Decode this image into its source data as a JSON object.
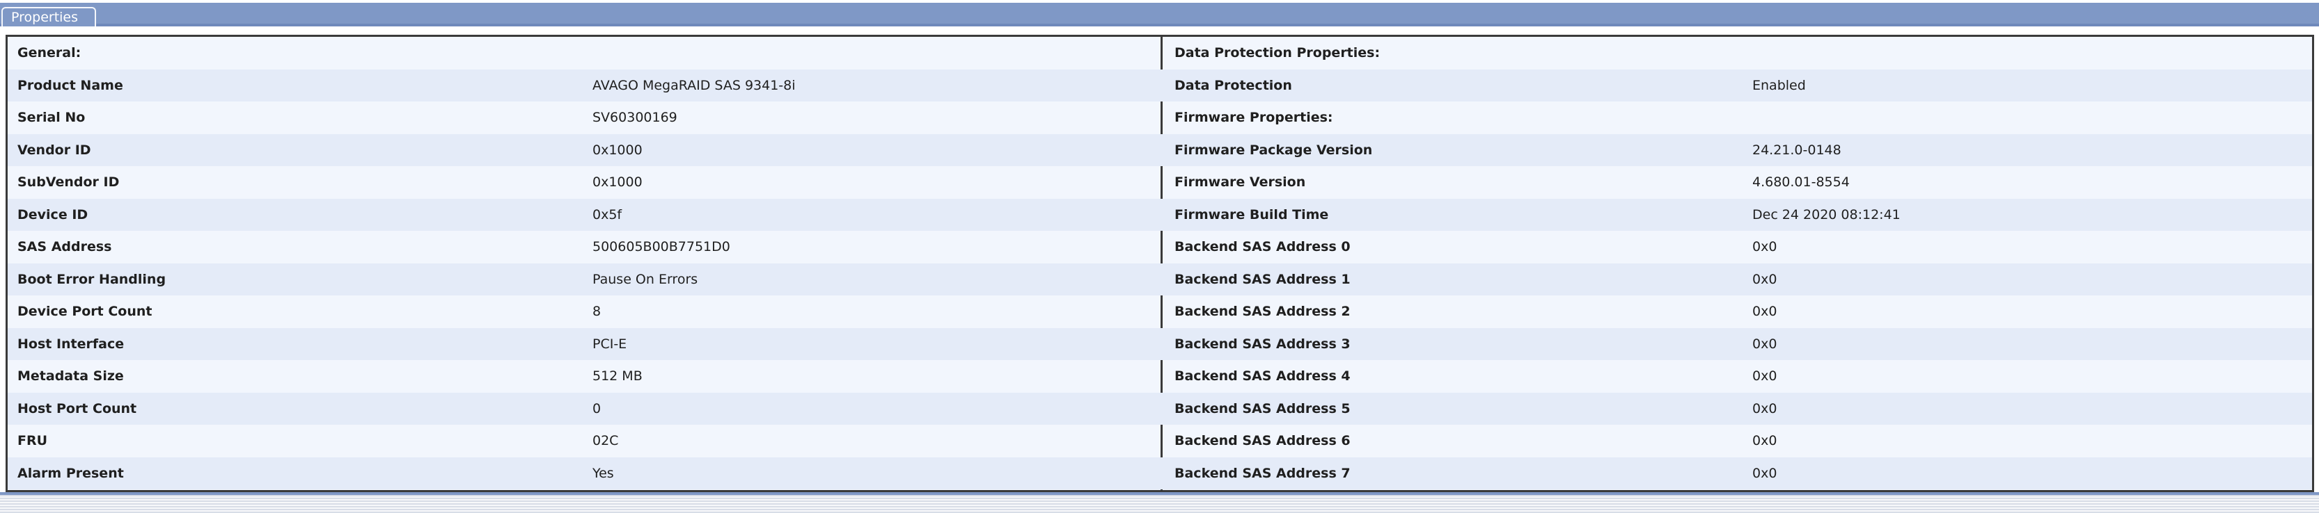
{
  "tab": {
    "label": "Properties"
  },
  "left_rows": [
    {
      "key": "General:",
      "value": ""
    },
    {
      "key": "Product Name",
      "value": "AVAGO MegaRAID SAS 9341-8i"
    },
    {
      "key": "Serial No",
      "value": "SV60300169"
    },
    {
      "key": "Vendor ID",
      "value": "0x1000"
    },
    {
      "key": "SubVendor ID",
      "value": "0x1000"
    },
    {
      "key": "Device ID",
      "value": "0x5f"
    },
    {
      "key": "SAS Address",
      "value": "500605B00B7751D0"
    },
    {
      "key": "Boot Error Handling",
      "value": "Pause On Errors"
    },
    {
      "key": "Device Port Count",
      "value": "8"
    },
    {
      "key": "Host Interface",
      "value": "PCI-E"
    },
    {
      "key": "Metadata Size",
      "value": "512 MB"
    },
    {
      "key": "Host Port Count",
      "value": "0"
    },
    {
      "key": "FRU",
      "value": "02C"
    },
    {
      "key": "Alarm Present",
      "value": "Yes"
    }
  ],
  "right_rows": [
    {
      "key": "Data Protection Properties:",
      "value": ""
    },
    {
      "key": "Data Protection",
      "value": "Enabled"
    },
    {
      "key": "Firmware Properties:",
      "value": ""
    },
    {
      "key": "Firmware Package Version",
      "value": "24.21.0-0148"
    },
    {
      "key": "Firmware Version",
      "value": "4.680.01-8554"
    },
    {
      "key": "Firmware Build Time",
      "value": "Dec 24 2020  08:12:41"
    },
    {
      "key": "Backend SAS Address 0",
      "value": "0x0"
    },
    {
      "key": "Backend SAS Address 1",
      "value": "0x0"
    },
    {
      "key": "Backend SAS Address 2",
      "value": "0x0"
    },
    {
      "key": "Backend SAS Address 3",
      "value": "0x0"
    },
    {
      "key": "Backend SAS Address 4",
      "value": "0x0"
    },
    {
      "key": "Backend SAS Address 5",
      "value": "0x0"
    },
    {
      "key": "Backend SAS Address 6",
      "value": "0x0"
    },
    {
      "key": "Backend SAS Address 7",
      "value": "0x0"
    }
  ],
  "colors": {
    "tabbar": "#7f98c6",
    "row_light": "#f2f6fd",
    "row_alt": "#e4ebf8",
    "border": "#3a3a3a"
  }
}
